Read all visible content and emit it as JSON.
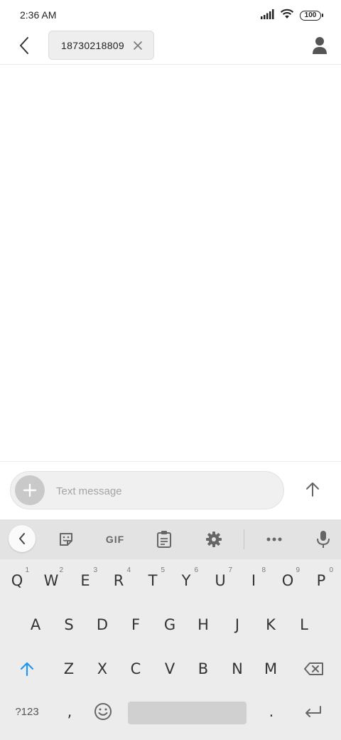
{
  "status_bar": {
    "time": "2:36 AM",
    "signal_icon": "signal-bars-icon",
    "wifi_icon": "wifi-icon",
    "battery_level": "100"
  },
  "header": {
    "back_icon": "chevron-left-icon",
    "recipient": "18730218809",
    "remove_icon": "close-icon",
    "contact_icon": "person-icon"
  },
  "compose": {
    "attach_icon": "plus-icon",
    "placeholder": "Text message",
    "value": "",
    "send_icon": "arrow-up-icon"
  },
  "keyboard": {
    "toolbar": {
      "collapse_icon": "chevron-left-icon",
      "sticker_icon": "sticker-icon",
      "gif_label": "GIF",
      "clipboard_icon": "clipboard-icon",
      "settings_icon": "gear-icon",
      "more_icon": "more-horizontal-icon",
      "mic_icon": "microphone-icon"
    },
    "row1": [
      {
        "key": "Q",
        "hint": "1"
      },
      {
        "key": "W",
        "hint": "2"
      },
      {
        "key": "E",
        "hint": "3"
      },
      {
        "key": "R",
        "hint": "4"
      },
      {
        "key": "T",
        "hint": "5"
      },
      {
        "key": "Y",
        "hint": "6"
      },
      {
        "key": "U",
        "hint": "7"
      },
      {
        "key": "I",
        "hint": "8"
      },
      {
        "key": "O",
        "hint": "9"
      },
      {
        "key": "P",
        "hint": "0"
      }
    ],
    "row2": [
      "A",
      "S",
      "D",
      "F",
      "G",
      "H",
      "J",
      "K",
      "L"
    ],
    "row3": [
      "Z",
      "X",
      "C",
      "V",
      "B",
      "N",
      "M"
    ],
    "shift_icon": "shift-arrow-icon",
    "backspace_icon": "backspace-icon",
    "symbols_label": "?123",
    "comma": ",",
    "emoji_icon": "smiley-icon",
    "period": ".",
    "enter_icon": "enter-icon",
    "accent_color": "#2196f3"
  }
}
